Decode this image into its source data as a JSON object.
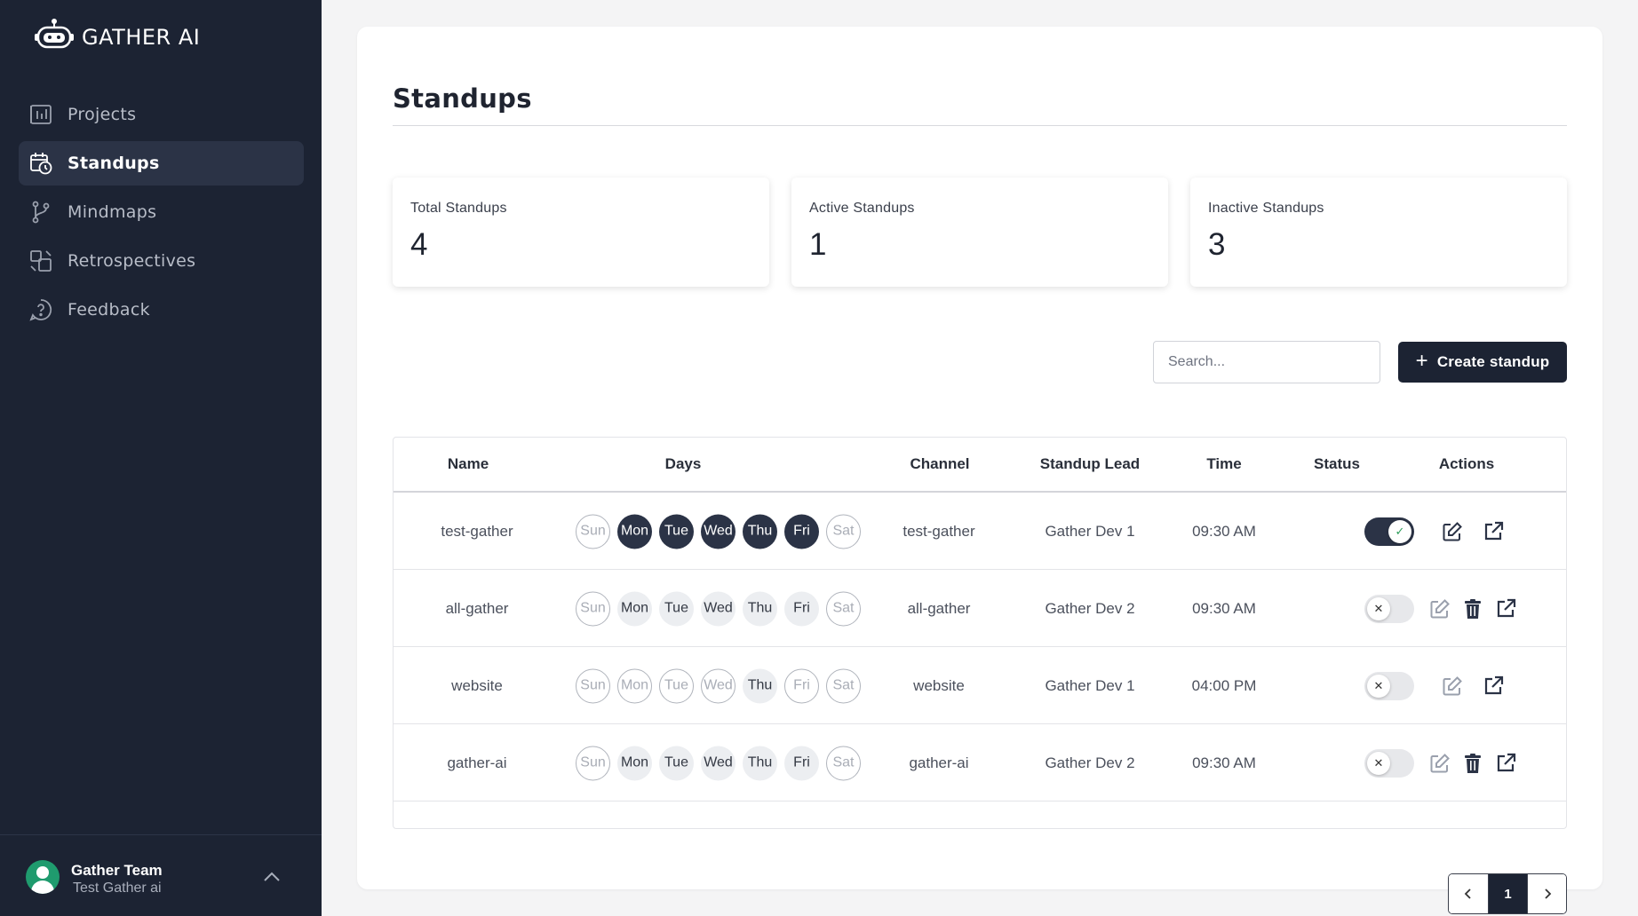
{
  "app": {
    "name": "GATHER AI"
  },
  "nav": [
    {
      "label": "Projects",
      "icon": "chart-board-icon"
    },
    {
      "label": "Standups",
      "icon": "calendar-clock-icon",
      "active": true
    },
    {
      "label": "Mindmaps",
      "icon": "git-branch-icon"
    },
    {
      "label": "Retrospectives",
      "icon": "shapes-icon"
    },
    {
      "label": "Feedback",
      "icon": "help-chat-icon"
    }
  ],
  "user": {
    "name": "Gather Team",
    "org": "Test Gather ai"
  },
  "page": {
    "title": "Standups"
  },
  "stats": {
    "total": {
      "label": "Total Standups",
      "value": "4"
    },
    "active": {
      "label": "Active Standups",
      "value": "1"
    },
    "inactive": {
      "label": "Inactive Standups",
      "value": "3"
    }
  },
  "toolbar": {
    "search_placeholder": "Search...",
    "create_label": "Create standup"
  },
  "table": {
    "headers": {
      "name": "Name",
      "days": "Days",
      "channel": "Channel",
      "lead": "Standup Lead",
      "time": "Time",
      "status": "Status",
      "actions": "Actions"
    },
    "day_names": [
      "Sun",
      "Mon",
      "Tue",
      "Wed",
      "Thu",
      "Fri",
      "Sat"
    ],
    "rows": [
      {
        "name": "test-gather",
        "channel": "test-gather",
        "lead": "Gather Dev 1",
        "time": "09:30 AM",
        "status": "active",
        "days": [
          "off",
          "on",
          "on",
          "on",
          "on",
          "on",
          "off"
        ],
        "can_delete": false
      },
      {
        "name": "all-gather",
        "channel": "all-gather",
        "lead": "Gather Dev 2",
        "time": "09:30 AM",
        "status": "inactive",
        "days": [
          "off",
          "inc",
          "inc",
          "inc",
          "inc",
          "inc",
          "off"
        ],
        "can_delete": true
      },
      {
        "name": "website",
        "channel": "website",
        "lead": "Gather Dev 1",
        "time": "04:00 PM",
        "status": "inactive",
        "days": [
          "off",
          "off",
          "off",
          "off",
          "inc",
          "off",
          "off"
        ],
        "can_delete": false
      },
      {
        "name": "gather-ai",
        "channel": "gather-ai",
        "lead": "Gather Dev 2",
        "time": "09:30 AM",
        "status": "inactive",
        "days": [
          "off",
          "inc",
          "inc",
          "inc",
          "inc",
          "inc",
          "off"
        ],
        "can_delete": true
      }
    ]
  },
  "pagination": {
    "current": "1"
  },
  "colors": {
    "sidebar": "#1c2333",
    "accent": "#2b3346",
    "success": "#2f9d5b"
  }
}
